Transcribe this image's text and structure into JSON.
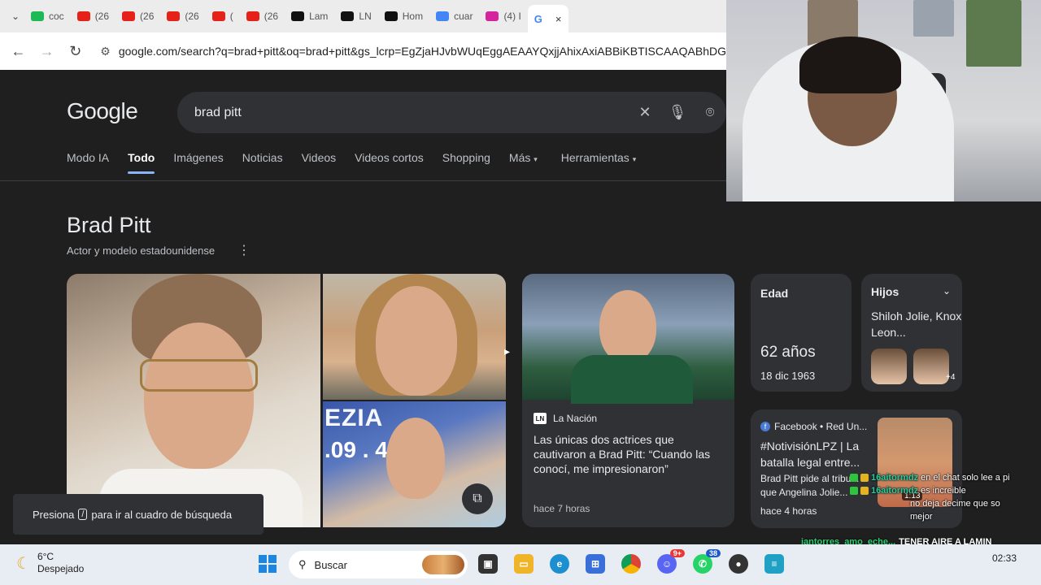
{
  "browser": {
    "tabs": [
      {
        "label": "coc",
        "color": "#1db954"
      },
      {
        "label": "(26",
        "color": "#e62117"
      },
      {
        "label": "(26",
        "color": "#e62117"
      },
      {
        "label": "(26",
        "color": "#e62117"
      },
      {
        "label": "(",
        "color": "#e62117"
      },
      {
        "label": "(26",
        "color": "#e62117"
      },
      {
        "label": "Lam",
        "color": "#111111"
      },
      {
        "label": "LN",
        "color": "#111111"
      },
      {
        "label": "Hom",
        "color": "#111111"
      },
      {
        "label": "cuar",
        "color": "#4285f4"
      },
      {
        "label": "(4) I",
        "color": "#d6249f"
      }
    ],
    "active_tab_close": "×",
    "url": "google.com/search?q=brad+pitt&oq=brad+pitt&gs_lcrp=EgZjaHJvbWUqEggAEAAYQxjjAhixAxiABBiKBTISCAAQABhDG"
  },
  "search": {
    "logo": "Google",
    "query": "brad pitt",
    "tabs": [
      "Modo IA",
      "Todo",
      "Imágenes",
      "Noticias",
      "Videos",
      "Videos cortos",
      "Shopping",
      "Más",
      "Herramientas"
    ],
    "selected_tab": "Todo"
  },
  "knowledge_panel": {
    "title": "Brad Pitt",
    "subtitle": "Actor y modelo estadounidense",
    "image_text_1": "EZIA",
    "image_text_2": ".09 . 4",
    "age_label": "Edad",
    "age_value": "62 años",
    "birth_date": "18 dic 1963",
    "kids_label": "Hijos",
    "kids_value": "Shiloh Jolie, Knox Leon...",
    "kids_more": "+4"
  },
  "news_card": {
    "source": "La Nación",
    "source_badge": "LN",
    "headline": "Las únicas dos actrices que cautivaron a Brad Pitt: “Cuando las conocí, me impresionaron”",
    "time": "hace 7 horas"
  },
  "fb_card": {
    "source": "Facebook • Red Un...",
    "headline": "#NotivisiónLPZ | La batalla legal entre...",
    "snippet": "Brad Pitt pide al tribu... que Angelina Jolie...",
    "time": "hace 4 horas",
    "video_time": "1:13"
  },
  "toast": {
    "before": "Presiona",
    "key": "/",
    "after": "para ir al cuadro de búsqueda"
  },
  "chat": [
    {
      "user": "16aitormdz",
      "msg": "en el chat solo lee a pi"
    },
    {
      "user": "16aitormdz",
      "msg": "es increible"
    },
    {
      "user": "",
      "msg": "no deja decime que so"
    },
    {
      "user": "",
      "msg": "mejor"
    }
  ],
  "chat_bottom": {
    "user": "iantorres_amo_eche...",
    "msg": "TENER AIRE A LAMIN"
  },
  "taskbar": {
    "temp": "6°C",
    "weather": "Despejado",
    "search_placeholder": "Buscar",
    "whatsapp_badge": "38",
    "discord_badge": "9+",
    "time": "02:33"
  }
}
